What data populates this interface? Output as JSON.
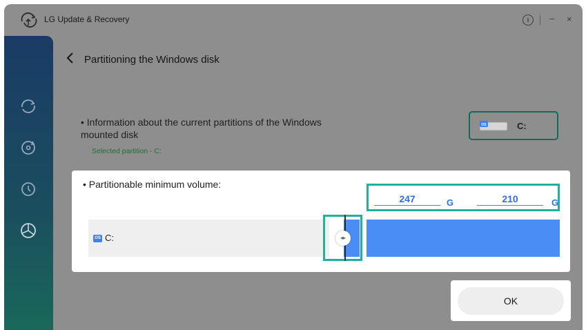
{
  "titlebar": {
    "title": "LG Update & Recovery",
    "info_icon": "info-icon",
    "minimize": "–",
    "close": "×"
  },
  "sidebar": {
    "items": [
      {
        "icon": "update-recovery-icon"
      },
      {
        "icon": "restore-icon"
      },
      {
        "icon": "history-icon"
      },
      {
        "icon": "disk-partition-icon"
      }
    ]
  },
  "header": {
    "title": "Partitioning the Windows disk"
  },
  "info": {
    "bullet_text": "• Information about the current partitions of the Windows mounted disk",
    "selected_partition": "Selected partition - C:"
  },
  "partition_card": {
    "badge": "OS",
    "label": "C:"
  },
  "panel": {
    "min_volume_label": "• Partitionable minimum volume:",
    "volume_1": "247",
    "volume_2": "210",
    "unit": "G",
    "partition_badge": "OS",
    "partition_label": "C:",
    "handle_glyph": "◂▸"
  },
  "footer": {
    "ok_label": "OK"
  },
  "colors": {
    "accent_blue": "#4a8ef5",
    "highlight_teal": "#21b0a0",
    "sidebar_top": "#1a3b65",
    "sidebar_bottom": "#19685a"
  }
}
